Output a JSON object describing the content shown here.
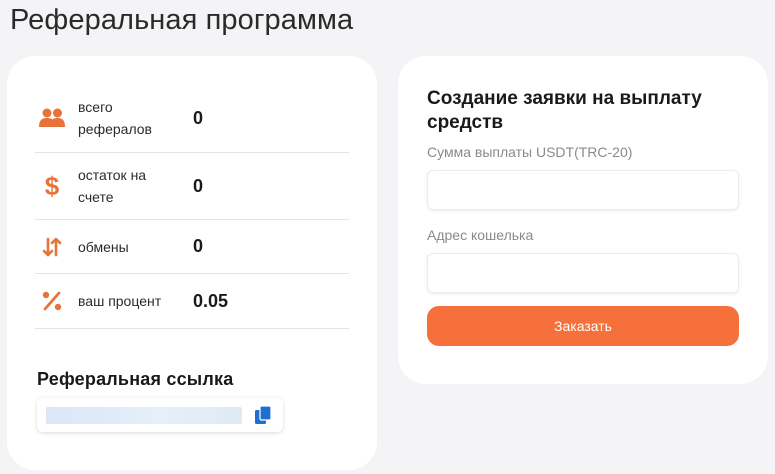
{
  "page": {
    "title": "Реферальная программа"
  },
  "stats": [
    {
      "label": "всего рефералов",
      "value": "0",
      "icon": "users-icon"
    },
    {
      "label": "остаток на счете",
      "value": "0",
      "icon": "dollar-icon"
    },
    {
      "label": "обмены",
      "value": "0",
      "icon": "exchange-arrows-icon"
    },
    {
      "label": "ваш процент",
      "value": "0.05",
      "icon": "percent-icon"
    }
  ],
  "referral": {
    "title": "Реферальная ссылка",
    "copy_icon": "copy-icon"
  },
  "withdraw": {
    "title": "Создание заявки на выплату средств",
    "amount_label": "Сумма выплаты USDT(TRC-20)",
    "amount_value": "",
    "wallet_label": "Адрес кошелька",
    "wallet_value": "",
    "submit_label": "Заказать"
  },
  "colors": {
    "accent": "#f5703a",
    "icon": "#e8733a",
    "copy_icon": "#1f6fd1",
    "background": "#f4f4f6"
  }
}
